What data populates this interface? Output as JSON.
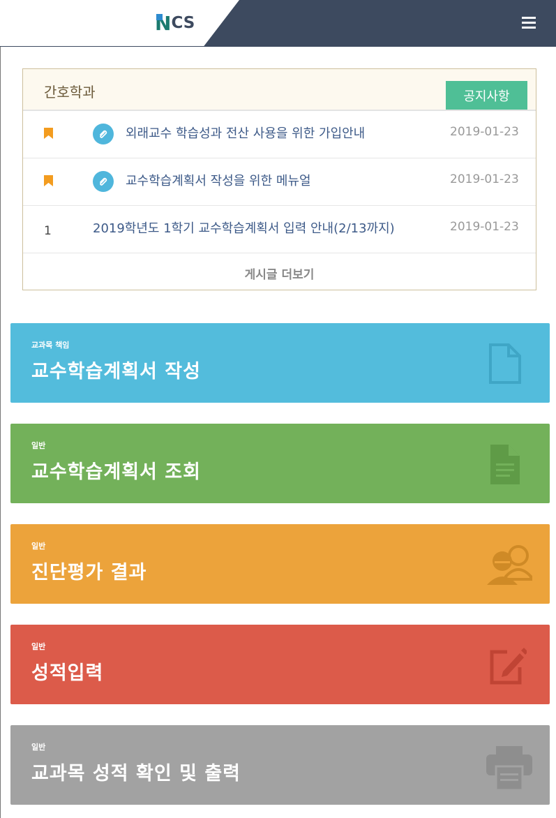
{
  "header": {
    "logo_n": "N",
    "logo_cs": "CS",
    "menu_icon": "hamburger-menu-icon",
    "colors": {
      "bar": "#3d4a5f"
    }
  },
  "notice": {
    "title": "간호학과",
    "tab_label": "공지사항",
    "more_label": "게시글 더보기",
    "rows": [
      {
        "marker": "bookmark-icon",
        "attachment": true,
        "title": "외래교수 학습성과 전산 사용을 위한 가입안내",
        "date": "2019-01-23"
      },
      {
        "marker": "bookmark-icon",
        "attachment": true,
        "title": "교수학습계획서 작성을 위한 메뉴얼",
        "date": "2019-01-23"
      },
      {
        "marker": "1",
        "attachment": false,
        "title": "2019학년도 1학기 교수학습계획서 입력 안내(2/13까지)",
        "date": "2019-01-23"
      }
    ]
  },
  "tiles": [
    {
      "category": "교과목 책임",
      "title": "교수학습계획서 작성",
      "color": "#53bcdc",
      "icon": "blank-document-icon"
    },
    {
      "category": "일반",
      "title": "교수학습계획서 조회",
      "color": "#73b15a",
      "icon": "text-document-icon"
    },
    {
      "category": "일반",
      "title": "진단평가 결과",
      "color": "#eca33b",
      "icon": "users-icon"
    },
    {
      "category": "일반",
      "title": "성적입력",
      "color": "#dc5b4a",
      "icon": "edit-icon"
    },
    {
      "category": "일반",
      "title": "교과목 성적 확인 및 출력",
      "color": "#a2a2a2",
      "icon": "printer-icon"
    }
  ]
}
